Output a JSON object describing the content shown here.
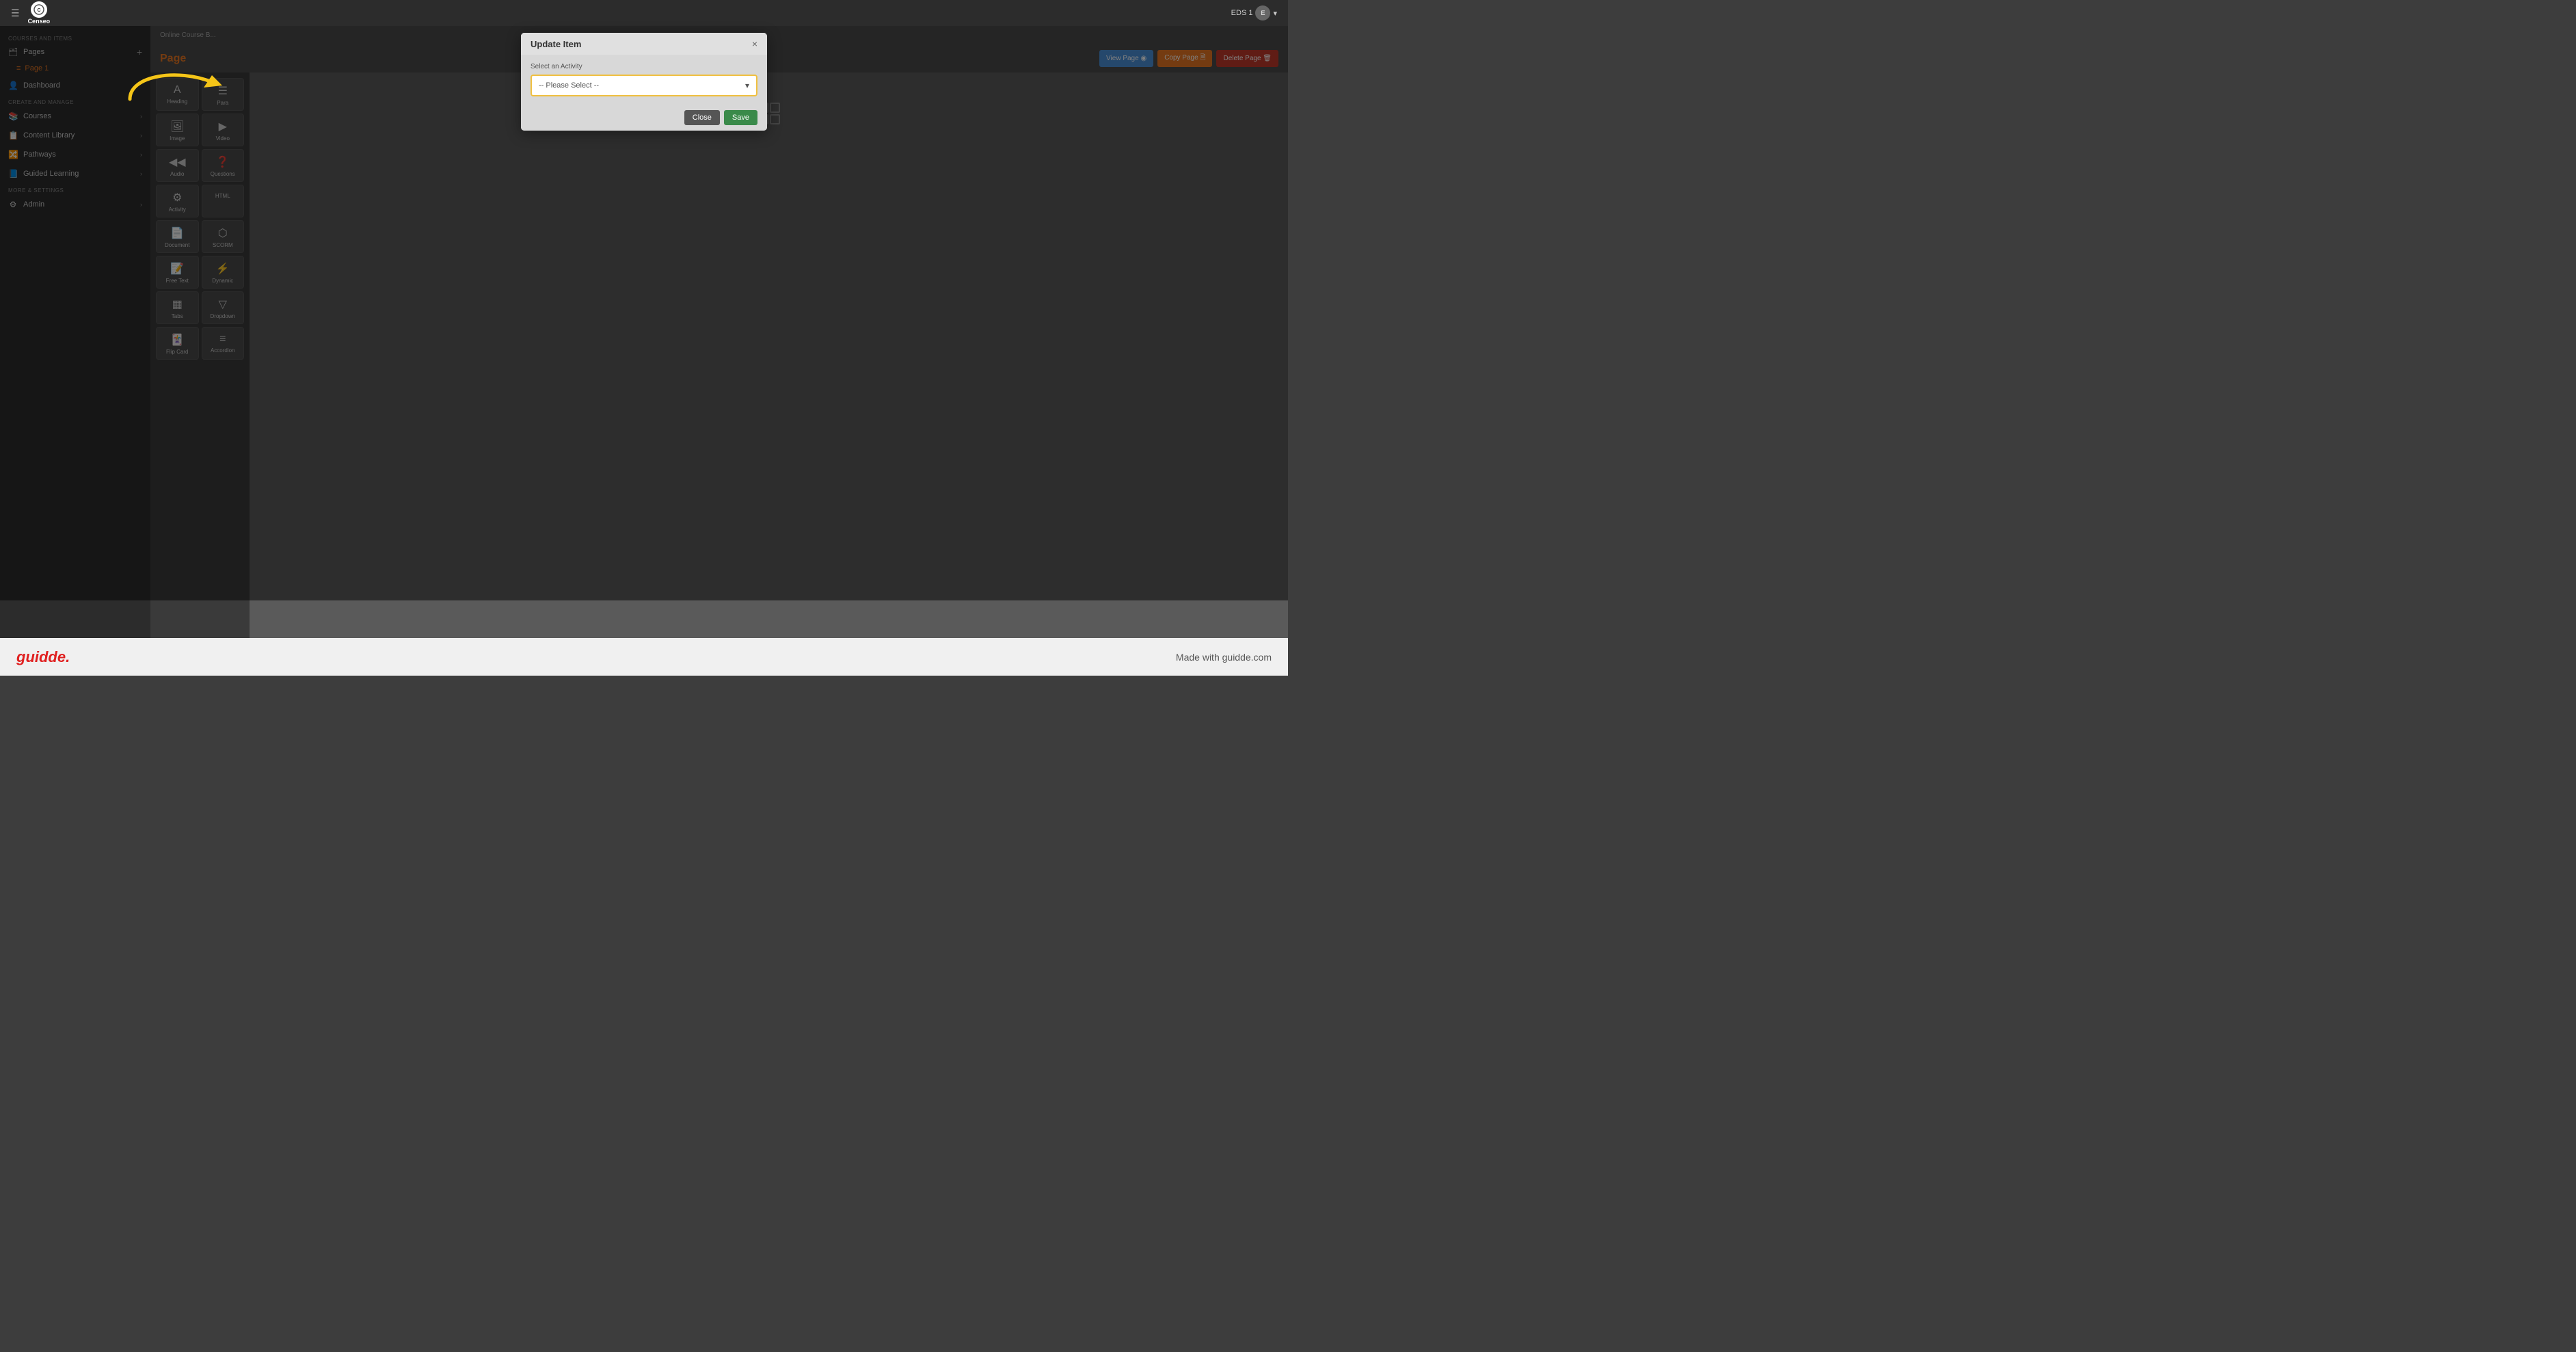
{
  "app": {
    "name": "Censeo",
    "logo_text": "Censeo"
  },
  "topnav": {
    "user": "EDS 1",
    "user_avatar": "E",
    "chevron": "▾"
  },
  "breadcrumb": {
    "text": "COURSES AND ITEMS"
  },
  "sidebar": {
    "pages_label": "Pages",
    "pages_add": "+",
    "page1_label": "Page 1",
    "page1_icon": "≡",
    "dashboard_label": "Dashboard",
    "create_and_manage": "CREATE AND MANAGE",
    "courses_label": "Courses",
    "content_library_label": "Content Library",
    "pathways_label": "Pathways",
    "guided_learning_label": "Guided Learning",
    "more_and_settings": "MORE & SETTINGS",
    "admin_label": "Admin"
  },
  "page": {
    "title": "Page",
    "breadcrumb": "Online Course B...",
    "view_page_label": "View Page ◉",
    "copy_page_label": "Copy Page 🗎",
    "delete_page_label": "Delete Page 🗑"
  },
  "block_palette": {
    "items": [
      {
        "icon": "A",
        "label": "Heading"
      },
      {
        "icon": "☰",
        "label": "Para"
      },
      {
        "icon": "🖼",
        "label": "Image"
      },
      {
        "icon": "▶",
        "label": "Video"
      },
      {
        "icon": "◀◀",
        "label": "Audio"
      },
      {
        "icon": "❓",
        "label": "Questions"
      },
      {
        "icon": "⚙",
        "label": "Activity"
      },
      {
        "icon": "</>",
        "label": "HTML"
      },
      {
        "icon": "📄",
        "label": "Document"
      },
      {
        "icon": "⬡",
        "label": "SCORM"
      },
      {
        "icon": "📝",
        "label": "Free Text"
      },
      {
        "icon": "⚡",
        "label": "Dynamic"
      },
      {
        "icon": "▦",
        "label": "Tabs"
      },
      {
        "icon": "▽",
        "label": "Dropdown"
      },
      {
        "icon": "🃏",
        "label": "Flip Card"
      },
      {
        "icon": "≡",
        "label": "Accordion"
      }
    ]
  },
  "modal": {
    "title": "Update Item",
    "close_label": "×",
    "select_label": "Select an Activity",
    "select_placeholder": "-- Please Select --",
    "close_btn": "Close",
    "save_btn": "Save"
  },
  "footer": {
    "logo": "guidde.",
    "text": "Made with guidde.com"
  },
  "colors": {
    "accent_orange": "#e87722",
    "arrow_color": "#f5c518",
    "modal_border": "#f0c040"
  }
}
